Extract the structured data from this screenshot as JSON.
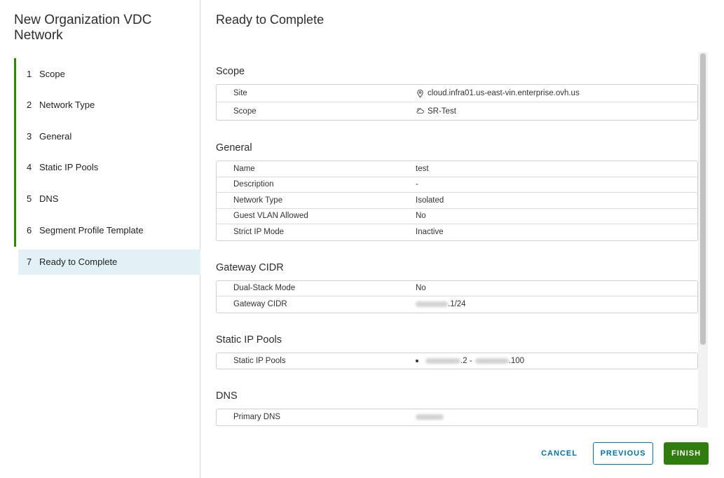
{
  "wizard": {
    "title": "New Organization VDC Network",
    "steps": [
      {
        "num": "1",
        "label": "Scope"
      },
      {
        "num": "2",
        "label": "Network Type"
      },
      {
        "num": "3",
        "label": "General"
      },
      {
        "num": "4",
        "label": "Static IP Pools"
      },
      {
        "num": "5",
        "label": "DNS"
      },
      {
        "num": "6",
        "label": "Segment Profile Template"
      },
      {
        "num": "7",
        "label": "Ready to Complete"
      }
    ],
    "current_step": 7
  },
  "main": {
    "title": "Ready to Complete",
    "sections": {
      "scope": {
        "title": "Scope",
        "rows": [
          {
            "key": "Site",
            "value": "cloud.infra01.us-east-vin.enterprise.ovh.us",
            "icon": "location-pin-icon"
          },
          {
            "key": "Scope",
            "value": "SR-Test",
            "icon": "cloud-org-icon"
          }
        ]
      },
      "general": {
        "title": "General",
        "rows": [
          {
            "key": "Name",
            "value": "test"
          },
          {
            "key": "Description",
            "value": "-"
          },
          {
            "key": "Network Type",
            "value": "Isolated"
          },
          {
            "key": "Guest VLAN Allowed",
            "value": "No"
          },
          {
            "key": "Strict IP Mode",
            "value": "Inactive"
          }
        ]
      },
      "gateway": {
        "title": "Gateway CIDR",
        "rows": [
          {
            "key": "Dual-Stack Mode",
            "value": "No"
          },
          {
            "key": "Gateway CIDR",
            "value_suffix": ".1/24"
          }
        ]
      },
      "pools": {
        "title": "Static IP Pools",
        "rows": [
          {
            "key": "Static IP Pools",
            "value_start_suffix": ".2 -",
            "value_end_suffix": ".100"
          }
        ]
      },
      "dns": {
        "title": "DNS",
        "rows": [
          {
            "key": "Primary DNS"
          }
        ]
      }
    }
  },
  "footer": {
    "cancel_label": "CANCEL",
    "previous_label": "PREVIOUS",
    "finish_label": "FINISH"
  },
  "colors": {
    "accent_green": "#318700",
    "finish_green": "#2f7d0d",
    "link_blue": "#0072a3",
    "current_step_bg": "#e1f1f6"
  }
}
